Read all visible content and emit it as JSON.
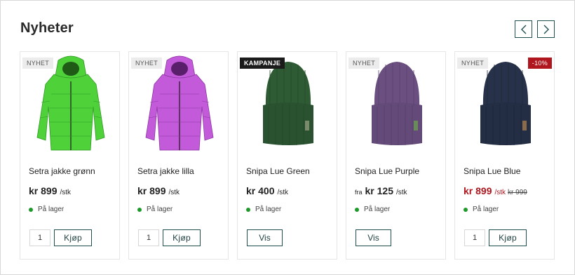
{
  "section": {
    "title": "Nyheter"
  },
  "nav": {
    "prev_icon": "chevron-left-icon",
    "next_icon": "chevron-right-icon"
  },
  "colors": {
    "accent": "#1f4f4f",
    "sale": "#b0161d",
    "in_stock": "#1e9a2a"
  },
  "products": [
    {
      "badge": "NYHET",
      "badge_type": "new",
      "name": "Setra jakke grønn",
      "from": "",
      "price": "kr 899",
      "unit": "/stk",
      "old_price": "",
      "stock": "På lager",
      "qty": "1",
      "action": "Kjøp",
      "image": "jacket-green",
      "image_color": "#4fd13a"
    },
    {
      "badge": "NYHET",
      "badge_type": "new",
      "name": "Setra jakke lilla",
      "from": "",
      "price": "kr 899",
      "unit": "/stk",
      "old_price": "",
      "stock": "På lager",
      "qty": "1",
      "action": "Kjøp",
      "image": "jacket-purple",
      "image_color": "#c35ad9"
    },
    {
      "badge": "KAMPANJE",
      "badge_type": "campaign",
      "name": "Snipa Lue Green",
      "from": "",
      "price": "kr 400",
      "unit": "/stk",
      "old_price": "",
      "stock": "På lager",
      "qty": "",
      "action": "Vis",
      "image": "beanie-green",
      "image_color": "#2f5b34"
    },
    {
      "badge": "NYHET",
      "badge_type": "new",
      "name": "Snipa Lue Purple",
      "from": "fra",
      "price": "kr 125",
      "unit": "/stk",
      "old_price": "",
      "stock": "På lager",
      "qty": "",
      "action": "Vis",
      "image": "beanie-purple",
      "image_color": "#6b4f80"
    },
    {
      "badge": "NYHET",
      "badge_type": "new",
      "discount": "-10%",
      "name": "Snipa Lue Blue",
      "from": "",
      "price": "kr 899",
      "unit": "/stk",
      "old_price": "kr 999",
      "stock": "På lager",
      "qty": "1",
      "action": "Kjøp",
      "image": "beanie-navy",
      "image_color": "#27324a"
    }
  ]
}
